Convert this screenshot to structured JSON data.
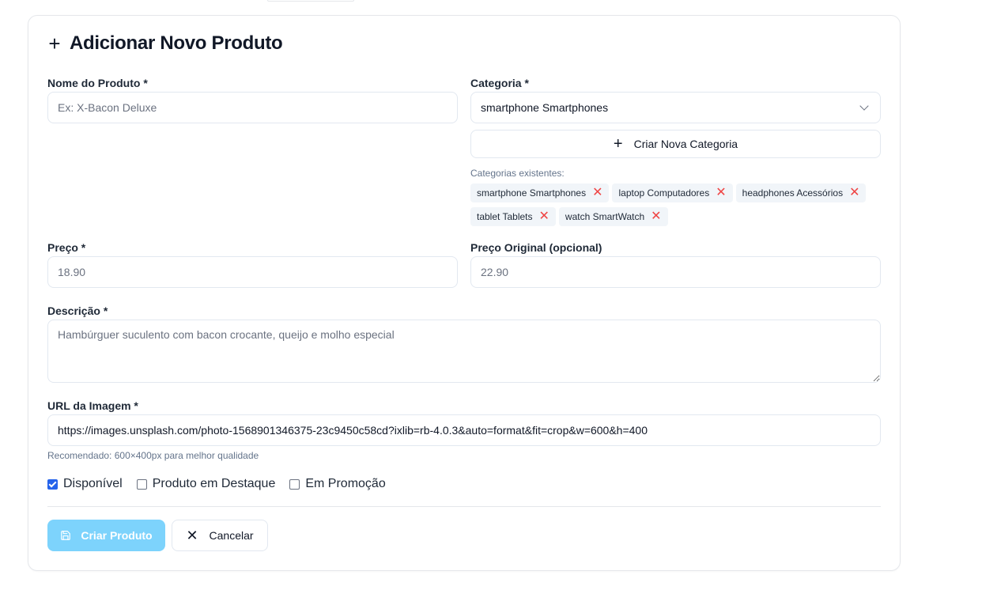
{
  "form": {
    "title": "Adicionar Novo Produto",
    "name_label": "Nome do Produto *",
    "name_placeholder": "Ex: X-Bacon Deluxe",
    "category_label": "Categoria *",
    "category_selected": "smartphone Smartphones",
    "new_category_button": "Criar Nova Categoria",
    "existing_categories_label": "Categorias existentes:",
    "existing_categories": [
      "smartphone Smartphones",
      "laptop Computadores",
      "headphones Acessórios",
      "tablet Tablets",
      "watch SmartWatch"
    ],
    "price_label": "Preço *",
    "price_placeholder": "18.90",
    "original_price_label": "Preço Original (opcional)",
    "original_price_placeholder": "22.90",
    "description_label": "Descrição *",
    "description_placeholder": "Hambúrguer suculento com bacon crocante, queijo e molho especial",
    "image_url_label": "URL da Imagem *",
    "image_url_value": "https://images.unsplash.com/photo-1568901346375-23c9450c58cd?ixlib=rb-4.0.3&auto=format&fit=crop&w=600&h=400",
    "image_hint": "Recomendado: 600×400px para melhor qualidade",
    "checkboxes": [
      {
        "label": "Disponível",
        "checked": true
      },
      {
        "label": "Produto em Destaque",
        "checked": false
      },
      {
        "label": "Em Promoção",
        "checked": false
      }
    ],
    "submit_label": "Criar Produto",
    "cancel_label": "Cancelar"
  },
  "colors": {
    "primary_disabled": "#7dd3fc",
    "checkbox_accent": "#2563eb",
    "remove_icon": "#ef4444"
  }
}
